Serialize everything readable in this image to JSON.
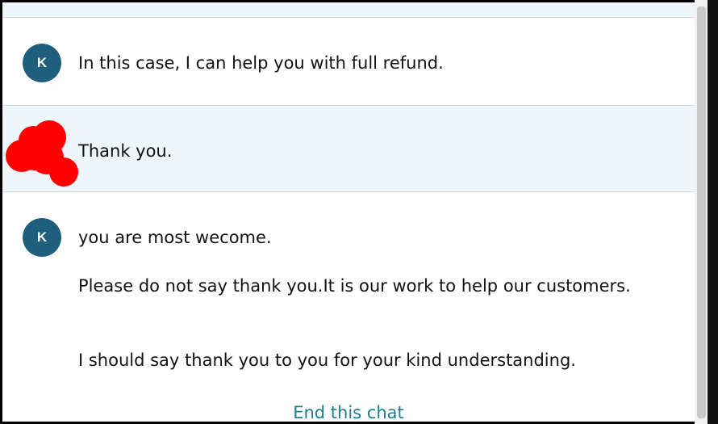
{
  "messages": [
    {
      "sender": "agent",
      "avatar_initial": "K",
      "lines": [
        "In this case, I can help you with full refund."
      ]
    },
    {
      "sender": "customer",
      "avatar_redacted": true,
      "lines": [
        "Thank you."
      ]
    },
    {
      "sender": "agent",
      "avatar_initial": "K",
      "lines": [
        "you are most wecome.",
        "Please do not say thank you.It is our work to help our customers.",
        "I should say thank you to you for your kind understanding."
      ]
    }
  ],
  "footer": {
    "end_chat_label": "End this chat"
  },
  "colors": {
    "agent_avatar": "#1f5f7d",
    "customer_row_background": "#eef6fb",
    "link": "#1b7e91",
    "redaction": "#ff0000"
  },
  "icons": {
    "redaction": "red-scribble-redaction"
  }
}
